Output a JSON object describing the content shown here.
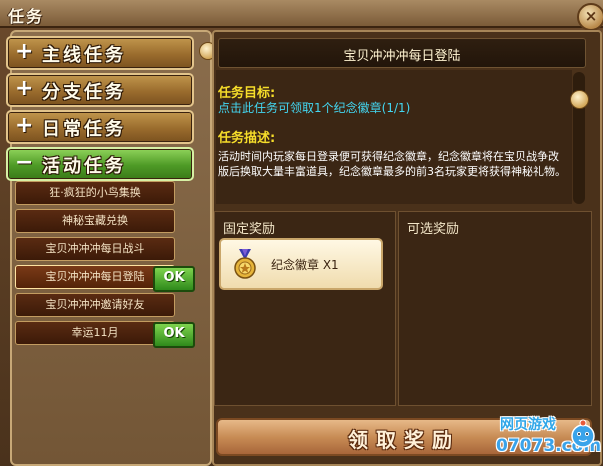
{
  "window": {
    "title": "任务",
    "close_label": "×"
  },
  "categories": [
    {
      "sign": "+",
      "label": "主线任务"
    },
    {
      "sign": "+",
      "label": "分支任务"
    },
    {
      "sign": "+",
      "label": "日常任务"
    },
    {
      "sign": "−",
      "label": "活动任务"
    }
  ],
  "subquests": [
    {
      "label": "狂·疯狂的小鸟集换"
    },
    {
      "label": "神秘宝藏兑换"
    },
    {
      "label": "宝贝冲冲冲每日战斗"
    },
    {
      "label": "宝贝冲冲冲每日登陆"
    },
    {
      "label": "宝贝冲冲冲邀请好友"
    },
    {
      "label": "幸运11月"
    }
  ],
  "ok_badge": "OK",
  "quest": {
    "title": "宝贝冲冲冲每日登陆",
    "goal_label": "任务目标:",
    "goal_text": "点击此任务可领取1个纪念徽章(1/1)",
    "desc_label": "任务描述:",
    "desc_text": "活动时间内玩家每日登录便可获得纪念徽章，纪念徽章将在宝贝战争改版后换取大量丰富道具，纪念徽章最多的前3名玩家更将获得神秘礼物。"
  },
  "rewards": {
    "fixed_title": "固定奖励",
    "optional_title": "可选奖励",
    "item_name": "纪念徽章 X1",
    "item_icon": "medal-icon"
  },
  "claim_button": "领取奖励",
  "watermark": {
    "line1": "网页游戏",
    "line2": "07073.com"
  },
  "colors": {
    "goal_text": "#43d7f2",
    "label_yellow": "#f6dd2a",
    "active_category": "#4e9a26"
  }
}
